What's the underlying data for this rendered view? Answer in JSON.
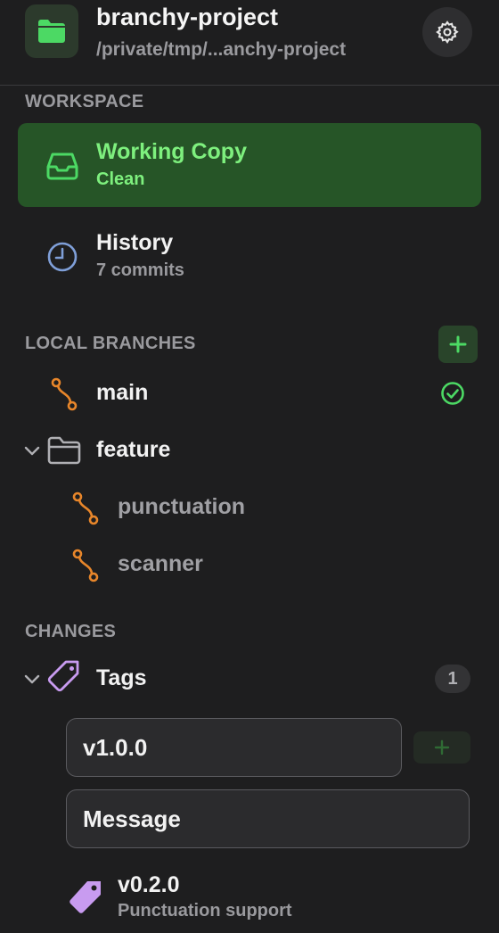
{
  "project": {
    "name": "branchy-project",
    "path": "/private/tmp/...anchy-project"
  },
  "workspace": {
    "section_label": "WORKSPACE",
    "items": [
      {
        "title": "Working Copy",
        "subtitle": "Clean",
        "active": true
      },
      {
        "title": "History",
        "subtitle": "7 commits",
        "active": false
      }
    ]
  },
  "local_branches": {
    "section_label": "LOCAL BRANCHES",
    "main": {
      "label": "main",
      "current": true
    },
    "folder": {
      "label": "feature",
      "expanded": true,
      "children": [
        {
          "label": "punctuation"
        },
        {
          "label": "scanner"
        }
      ]
    }
  },
  "changes": {
    "section_label": "CHANGES",
    "tags": {
      "label": "Tags",
      "count": "1",
      "expanded": true,
      "new_tag_name": "v1.0.0",
      "new_tag_message": "Message",
      "items": [
        {
          "name": "v0.2.0",
          "message": "Punctuation support"
        }
      ]
    }
  },
  "colors": {
    "accent_green": "#4cd964",
    "active_bg": "#265527",
    "branch_orange": "#e8862a",
    "tag_purple": "#c89bf0"
  },
  "icons": {
    "project": "folder-icon",
    "settings": "gear-icon",
    "working_copy": "inbox-tray-icon",
    "history": "clock-icon",
    "add": "plus-icon",
    "branch": "branch-icon",
    "current": "check-circle-icon",
    "folder": "folder-outline-icon",
    "chevron": "chevron-down-icon",
    "tag": "tag-icon"
  }
}
